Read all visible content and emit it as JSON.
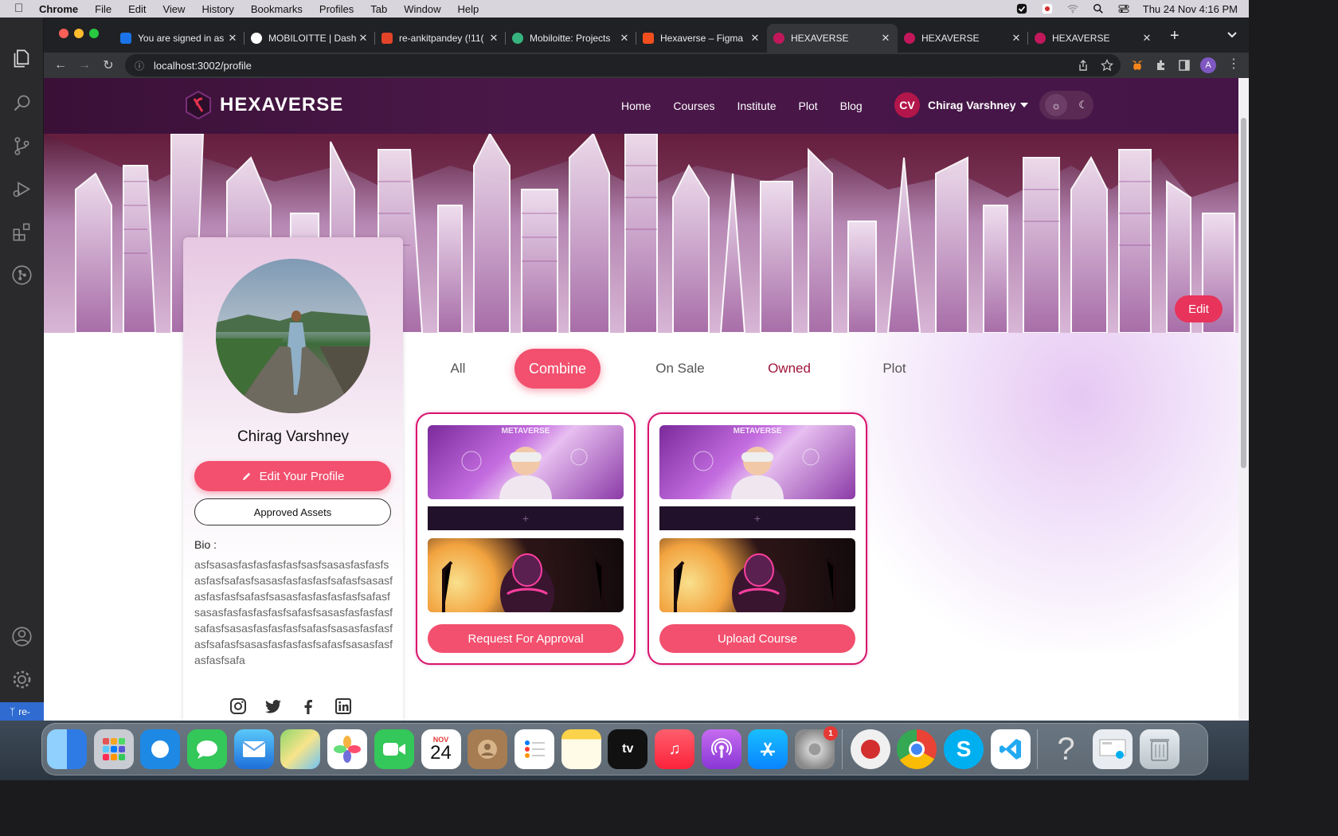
{
  "menubar": {
    "app": "Chrome",
    "items": [
      "File",
      "Edit",
      "View",
      "History",
      "Bookmarks",
      "Profiles",
      "Tab",
      "Window",
      "Help"
    ],
    "datetime": "Thu 24 Nov  4:16 PM"
  },
  "browser": {
    "tabs": [
      {
        "title": "You are signed in as",
        "color": "#1a73e8"
      },
      {
        "title": "MOBILOITTE | Dash",
        "color": "#ffffff"
      },
      {
        "title": "re-ankitpandey (!11(",
        "color": "#e24329"
      },
      {
        "title": "Mobiloitte: Projects",
        "color": "#36b37e"
      },
      {
        "title": "Hexaverse – Figma",
        "color": "#f24e1e"
      },
      {
        "title": "HEXAVERSE",
        "color": "#c2185b"
      },
      {
        "title": "HEXAVERSE",
        "color": "#c2185b"
      },
      {
        "title": "HEXAVERSE",
        "color": "#c2185b"
      }
    ],
    "url": "localhost:3002/profile"
  },
  "site": {
    "logo": "HEXAVERSE",
    "nav": [
      "Home",
      "Courses",
      "Institute",
      "Plot",
      "Blog"
    ],
    "user_initials": "CV",
    "user_name": "Chirag Varshney",
    "banner_edit": "Edit"
  },
  "profile": {
    "name": "Chirag Varshney",
    "edit_button": "Edit Your Profile",
    "approved_button": "Approved Assets",
    "bio_label": "Bio :",
    "bio_text": "asfsasasfasfasfasfasfsasfsasasfasfasfsasfasfsafasfsasasfasfasfasfsafasfsasasfasfasfasfsafasfsasasfasfasfasfasfsafasfsasasfasfasfasfasfsafasfsasasfasfasfasfsafasfsasasfasfasfasfsafasfsasasfasfasfasfsafasfsasasfasfasfasfsafasfsasasfasfasfasfsafa"
  },
  "filter_tabs": [
    "All",
    "Combine",
    "On Sale",
    "Owned",
    "Plot"
  ],
  "active_tab": "Combine",
  "cards": [
    {
      "banner_text": "METAVERSE",
      "plus": "+",
      "button": "Request For Approval"
    },
    {
      "banner_text": "METAVERSE",
      "plus": "+",
      "button": "Upload Course"
    }
  ],
  "vscode": {
    "branch": "re-"
  },
  "dock": {
    "calendar_month": "NOV",
    "calendar_day": "24",
    "settings_badge": "1",
    "apps": [
      "Finder",
      "Launchpad",
      "Safari",
      "Messages",
      "Mail",
      "Maps",
      "Photos",
      "FaceTime",
      "Calendar",
      "Contacts",
      "Reminders",
      "Notes",
      "TV",
      "Music",
      "Podcasts",
      "App Store",
      "System Preferences",
      "Record",
      "Chrome",
      "Skype",
      "VS Code",
      "Help",
      "Preview",
      "Trash"
    ]
  },
  "colors": {
    "accent": "#f2506e",
    "nav_bg": "#4a1848",
    "card_border": "#d9136a"
  }
}
